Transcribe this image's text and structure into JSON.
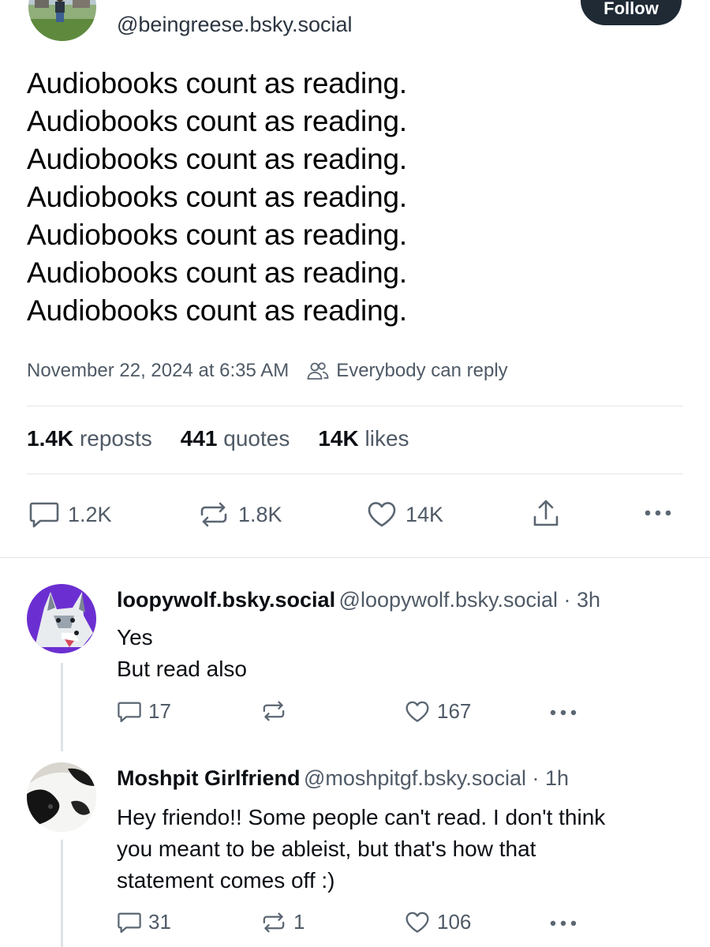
{
  "post": {
    "handle": "@beingreese.bsky.social",
    "follow_label": "Follow",
    "lines": [
      "Audiobooks count as reading.",
      "Audiobooks count as reading.",
      "Audiobooks count as reading.",
      "Audiobooks count as reading.",
      "Audiobooks count as reading.",
      "Audiobooks count as reading.",
      "Audiobooks count as reading."
    ],
    "timestamp": "November 22, 2024 at 6:35 AM",
    "reply_setting": "Everybody can reply",
    "stats": {
      "reposts_value": "1.4K",
      "reposts_label": "reposts",
      "quotes_value": "441",
      "quotes_label": "quotes",
      "likes_value": "14K",
      "likes_label": "likes"
    },
    "actions": {
      "replies": "1.2K",
      "reposts": "1.8K",
      "likes": "14K"
    }
  },
  "replies": [
    {
      "name": "loopywolf.bsky.social",
      "handle_time": "@loopywolf.bsky.social · 3h",
      "lines": [
        "Yes",
        "But read also"
      ],
      "replies": "17",
      "reposts": "",
      "likes": "167"
    },
    {
      "name": "Moshpit Girlfriend",
      "handle_time": "@moshpitgf.bsky.social · 1h",
      "lines": [
        "Hey friendo!! Some people can't read. I don't think",
        "you meant to be ableist, but that's how that",
        "statement comes off :)"
      ],
      "replies": "31",
      "reposts": "1",
      "likes": "106"
    }
  ],
  "icons": {
    "reply": "speech-bubble-icon",
    "repost": "repost-arrows-icon",
    "like": "heart-icon",
    "share": "share-upload-icon",
    "more": "more-dots-icon",
    "audience": "people-icon"
  },
  "colors": {
    "text": "#0b0f14",
    "muted": "#4f5a66",
    "button": "#1f2a35",
    "divider": "#e3e7eb"
  }
}
